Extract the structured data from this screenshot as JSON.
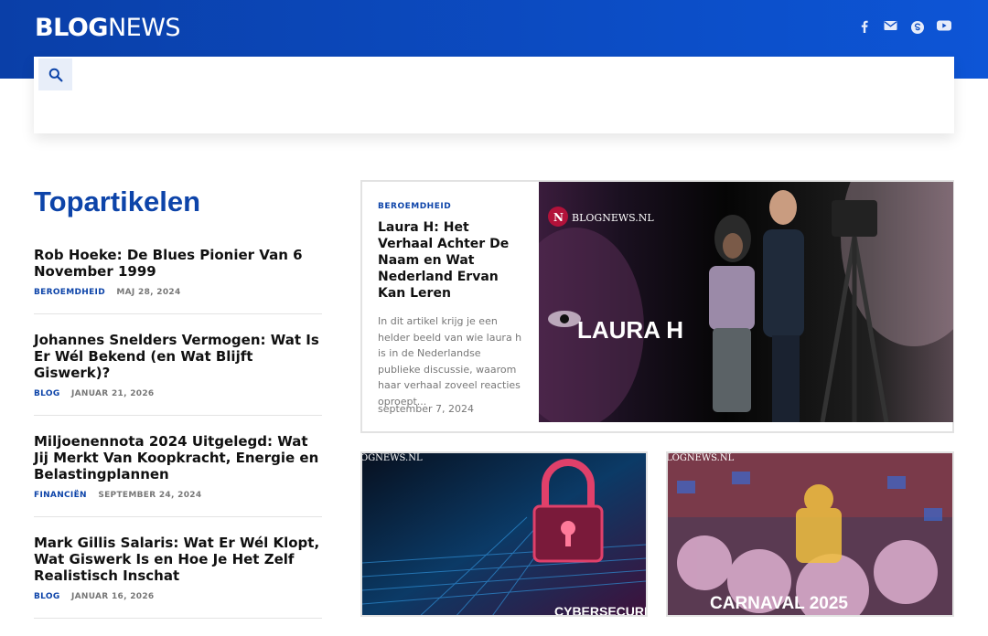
{
  "header": {
    "logo_bold": "BLOG",
    "logo_light": "NEWS",
    "social": [
      "facebook-icon",
      "mail-icon",
      "skype-icon",
      "youtube-icon"
    ]
  },
  "search": {
    "icon": "search-icon"
  },
  "sidebar": {
    "title": "Topartikelen",
    "items": [
      {
        "title": "Rob Hoeke: De Blues Pionier Van 6 November 1999",
        "category": "BEROEMDHEID",
        "date": "MAJ 28, 2024"
      },
      {
        "title": "Johannes Snelders Vermogen: Wat Is Er Wél Bekend (en Wat Blijft Giswerk)?",
        "category": "BLOG",
        "date": "JANUAR 21, 2026"
      },
      {
        "title": "Miljoenennota 2024 Uitgelegd: Wat Jij Merkt Van Koopkracht, Energie en Belastingplannen",
        "category": "FINANCIËN",
        "date": "SEPTEMBER 24, 2024"
      },
      {
        "title": "Mark Gillis Salaris: Wat Er Wél Klopt, Wat Giswerk Is en Hoe Je Het Zelf Realistisch Inschat",
        "category": "BLOG",
        "date": "JANUAR 16, 2026"
      }
    ]
  },
  "featured": {
    "category": "BEROEMDHEID",
    "title": "Laura H: Het Verhaal Achter De Naam en Wat Nederland Ervan Kan Leren",
    "excerpt": "In dit artikel krijg je een helder beeld van wie laura h is in de Nederlandse publieke discussie, waarom haar verhaal zoveel reacties oproept...",
    "date": "september 7, 2024",
    "image_watermark": "BLOGNEWS.NL",
    "image_caption": "LAURA H"
  },
  "cards": [
    {
      "watermark": "OGNEWS.NL",
      "caption": "CYBERSECURIT"
    },
    {
      "watermark": "LOGNEWS.NL",
      "caption": "CARNAVAL 2025"
    }
  ],
  "colors": {
    "brand": "#0d44a9",
    "header_start": "#0a3fa8",
    "header_end": "#0d55d6"
  }
}
